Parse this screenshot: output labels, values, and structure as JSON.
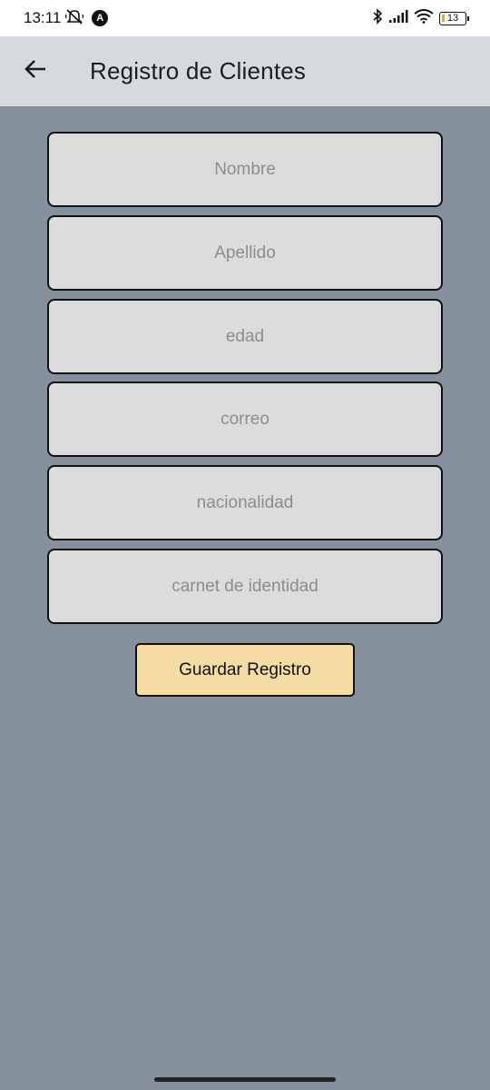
{
  "status_bar": {
    "time": "13:11",
    "battery_level": "13",
    "icons": [
      "mute-notifications-icon",
      "app-notification-icon",
      "bluetooth-icon",
      "signal-icon",
      "wifi-icon",
      "battery-icon"
    ]
  },
  "app_bar": {
    "title": "Registro de Clientes",
    "back_icon": "arrow-left-icon"
  },
  "form": {
    "fields": [
      {
        "placeholder": "Nombre",
        "value": ""
      },
      {
        "placeholder": "Apellido",
        "value": ""
      },
      {
        "placeholder": "edad",
        "value": ""
      },
      {
        "placeholder": "correo",
        "value": ""
      },
      {
        "placeholder": "nacionalidad",
        "value": ""
      },
      {
        "placeholder": "carnet de identidad",
        "value": ""
      }
    ],
    "submit_label": "Guardar Registro"
  },
  "colors": {
    "background": "#85919c",
    "app_bar": "#d6dade",
    "field_fill": "#dcdcdc",
    "button_fill": "#f5dca3",
    "border": "#111111"
  }
}
